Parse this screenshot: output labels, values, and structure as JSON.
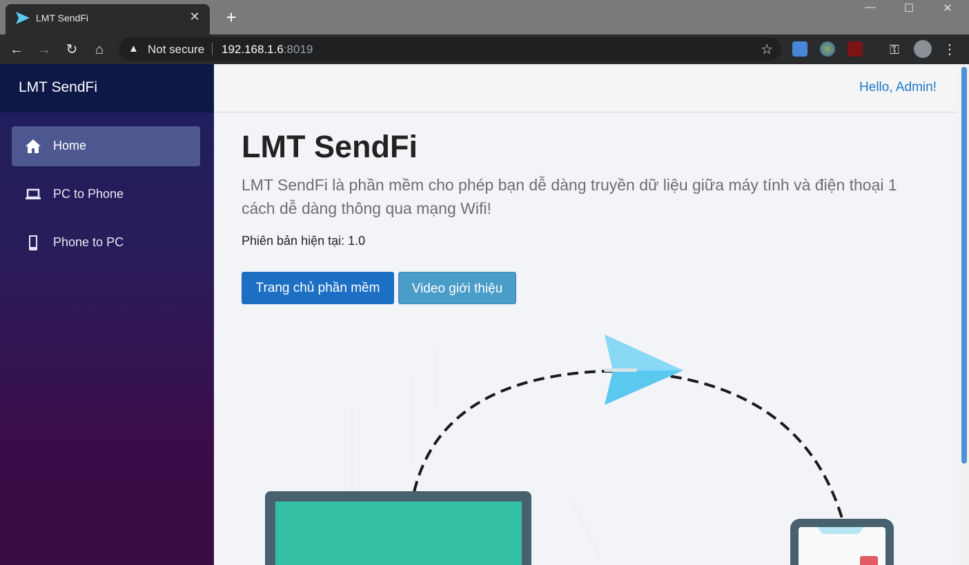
{
  "browser": {
    "tab_title": "LMT SendFi",
    "new_tab": "+",
    "security_label": "Not secure",
    "url_host": "192.168.1.6",
    "url_port": ":8019"
  },
  "sidebar": {
    "brand": "LMT SendFi",
    "items": [
      {
        "label": "Home",
        "icon": "home-icon",
        "active": true
      },
      {
        "label": "PC to Phone",
        "icon": "laptop-icon",
        "active": false
      },
      {
        "label": "Phone to PC",
        "icon": "phone-icon",
        "active": false
      }
    ]
  },
  "header": {
    "greeting": "Hello, Admin!"
  },
  "main": {
    "title": "LMT SendFi",
    "description": "LMT SendFi là phần mềm cho phép bạn dễ dàng truyền dữ liệu giữa máy tính và điện thoại 1 cách dễ dàng thông qua mạng Wifi!",
    "version_text": "Phiên bản hiện tại: 1.0",
    "buttons": {
      "homepage": "Trang chủ phần mềm",
      "video": "Video giới thiệu"
    }
  },
  "colors": {
    "accent": "#1d6fc4",
    "info": "#4a9cc9",
    "link": "#2077c9",
    "laptop_screen": "#34c0a4",
    "paper_plane": "#5bc8f0"
  }
}
